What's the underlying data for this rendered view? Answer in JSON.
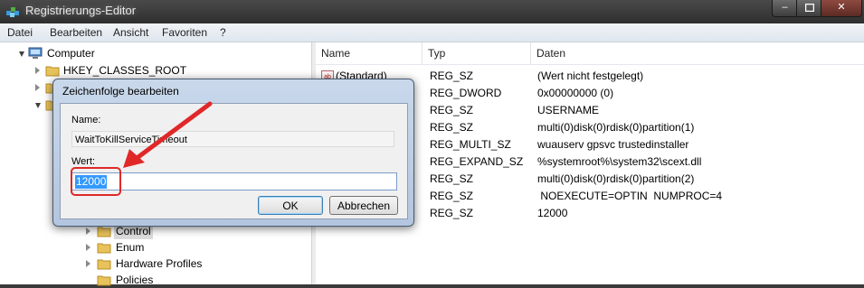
{
  "window": {
    "title": "Registrierungs-Editor",
    "minimize_glyph": "–",
    "close_glyph": "✕"
  },
  "menu": [
    "Datei",
    "Bearbeiten",
    "Ansicht",
    "Favoriten",
    "?"
  ],
  "tree": {
    "root": "Computer",
    "items": [
      "HKEY_CLASSES_ROOT"
    ],
    "subkeys": [
      "Control",
      "Enum",
      "Hardware Profiles",
      "Policies"
    ]
  },
  "list": {
    "columns": [
      "Name",
      "Typ",
      "Daten"
    ],
    "rows": [
      {
        "name": "(Standard)",
        "type": "REG_SZ",
        "data": "(Wert nicht festgelegt)",
        "icon": "string-value-icon"
      },
      {
        "name": "",
        "type": "REG_DWORD",
        "data": "0x00000000 (0)",
        "icon": "binary-value-icon"
      },
      {
        "name": "",
        "type": "REG_SZ",
        "data": "USERNAME",
        "icon": "string-value-icon"
      },
      {
        "name": "",
        "type": "REG_SZ",
        "data": "multi(0)disk(0)rdisk(0)partition(1)",
        "icon": "string-value-icon"
      },
      {
        "name": "",
        "type": "REG_MULTI_SZ",
        "data": "wuauserv gpsvc trustedinstaller",
        "icon": "string-value-icon"
      },
      {
        "name": "",
        "type": "REG_EXPAND_SZ",
        "data": "%systemroot%\\system32\\scext.dll",
        "icon": "string-value-icon"
      },
      {
        "name": "",
        "type": "REG_SZ",
        "data": "multi(0)disk(0)rdisk(0)partition(2)",
        "icon": "string-value-icon"
      },
      {
        "name": "",
        "type": "REG_SZ",
        "data": " NOEXECUTE=OPTIN  NUMPROC=4",
        "icon": "string-value-icon"
      },
      {
        "name": "",
        "type": "REG_SZ",
        "data": "12000",
        "icon": "string-value-icon"
      }
    ]
  },
  "dialog": {
    "title": "Zeichenfolge bearbeiten",
    "name_label": "Name:",
    "name_value": "WaitToKillServiceTimeout",
    "value_label": "Wert:",
    "value_value": "12000",
    "ok_label": "OK",
    "cancel_label": "Abbrechen"
  },
  "colors": {
    "annotation": "#e02828",
    "selection": "#3399ff",
    "folder": "#e8c25a"
  }
}
